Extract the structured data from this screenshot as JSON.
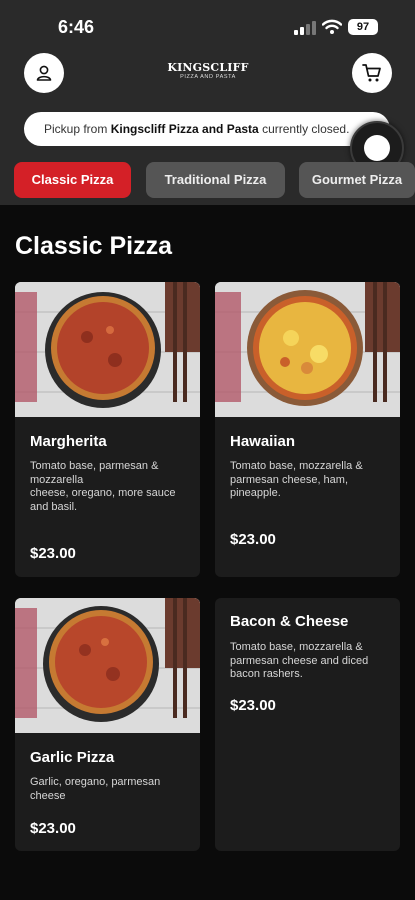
{
  "status_bar": {
    "time": "6:46",
    "battery": "97"
  },
  "header": {
    "logo_name": "KINGSCLIFF",
    "logo_tagline": "PIZZA AND PASTA",
    "pickup_prefix": "Pickup from ",
    "pickup_store": "Kingscliff Pizza and Pasta",
    "pickup_suffix": " currently closed."
  },
  "tabs": [
    {
      "label": "Classic Pizza",
      "active": true
    },
    {
      "label": "Traditional Pizza",
      "active": false
    },
    {
      "label": "Gourmet Pizza",
      "active": false
    }
  ],
  "section": {
    "title": "Classic Pizza"
  },
  "menu": [
    {
      "name": "Margherita",
      "description": "Tomato base, parmesan & mozzarella\ncheese, oregano, more sauce and basil.",
      "price": "$23.00",
      "image": "pizza-margherita"
    },
    {
      "name": "Hawaiian",
      "description": "Tomato base, mozzarella & parmesan cheese, ham, pineapple.",
      "price": "$23.00",
      "image": "pizza-hawaiian"
    },
    {
      "name": "Garlic Pizza",
      "description": "Garlic, oregano, parmesan cheese",
      "price": "$23.00",
      "image": "pizza-garlic"
    },
    {
      "name": "Bacon & Cheese",
      "description": "Tomato base, mozzarella & parmesan cheese and diced bacon rashers.",
      "price": "$23.00",
      "image": ""
    }
  ],
  "colors": {
    "accent": "#d42027",
    "header_bg": "#2a2a2a",
    "page_bg": "#0b0b0b",
    "card_bg": "#1c1c1c"
  }
}
